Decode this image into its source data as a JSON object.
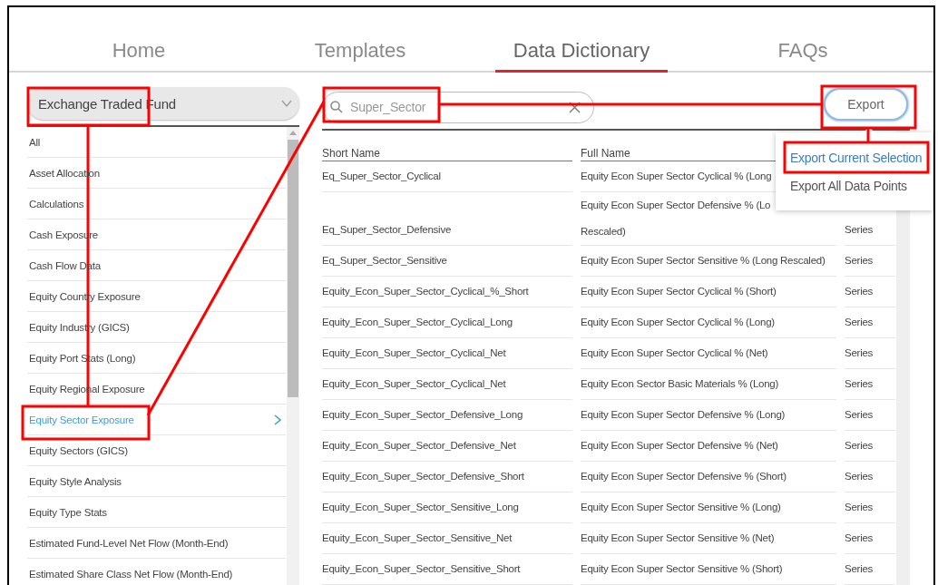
{
  "nav": {
    "tabs": [
      {
        "label": "Home",
        "selected": false
      },
      {
        "label": "Templates",
        "selected": false
      },
      {
        "label": "Data Dictionary",
        "selected": true
      },
      {
        "label": "FAQs",
        "selected": false
      }
    ]
  },
  "sidebar": {
    "dropdown": {
      "value": "Exchange Traded Fund"
    },
    "items": [
      {
        "label": "All",
        "selected": false
      },
      {
        "label": "Asset Allocation",
        "selected": false
      },
      {
        "label": "Calculations",
        "selected": false
      },
      {
        "label": "Cash Exposure",
        "selected": false
      },
      {
        "label": "Cash Flow Data",
        "selected": false
      },
      {
        "label": "Equity Country Exposure",
        "selected": false
      },
      {
        "label": "Equity Industry (GICS)",
        "selected": false
      },
      {
        "label": "Equity Port Stats (Long)",
        "selected": false
      },
      {
        "label": "Equity Regional Exposure",
        "selected": false
      },
      {
        "label": "Equity Sector Exposure",
        "selected": true
      },
      {
        "label": "Equity Sectors (GICS)",
        "selected": false
      },
      {
        "label": "Equity Style Analysis",
        "selected": false
      },
      {
        "label": "Equity Type Stats",
        "selected": false
      },
      {
        "label": "Estimated Fund-Level Net Flow (Month-End)",
        "selected": false
      },
      {
        "label": "Estimated Share Class Net Flow (Month-End)",
        "selected": false
      }
    ]
  },
  "search": {
    "value": "Super_Sector"
  },
  "export": {
    "label": "Export",
    "menu": [
      {
        "label": "Export Current Selection",
        "selected": true
      },
      {
        "label": "Export All Data Points",
        "selected": false
      }
    ]
  },
  "table": {
    "columns": [
      "Short Name",
      "Full Name"
    ],
    "rows": [
      {
        "short_name": "Eq_Super_Sector_Cyclical",
        "full_name_lines": [
          "Equity Econ Super Sector Cyclical % (Long"
        ]
      },
      {
        "short_name": "Eq_Super_Sector_Defensive",
        "full_name_lines": [
          "Equity Econ Super Sector Defensive % (Lo",
          "Rescaled)"
        ],
        "type": "Series"
      },
      {
        "short_name": "Eq_Super_Sector_Sensitive",
        "full_name_lines": [
          "Equity Econ Super Sector Sensitive % (Long Rescaled)"
        ],
        "type": "Series"
      },
      {
        "short_name": "Equity_Econ_Super_Sector_Cyclical_%_Short",
        "full_name_lines": [
          "Equity Econ Super Sector Cyclical % (Short)"
        ],
        "type": "Series"
      },
      {
        "short_name": "Equity_Econ_Super_Sector_Cyclical_Long",
        "full_name_lines": [
          "Equity Econ Super Sector Cyclical % (Long)"
        ],
        "type": "Series"
      },
      {
        "short_name": "Equity_Econ_Super_Sector_Cyclical_Net",
        "full_name_lines": [
          "Equity Econ Super Sector Cyclical % (Net)"
        ],
        "type": "Series"
      },
      {
        "short_name": "Equity_Econ_Super_Sector_Cyclical_Net",
        "full_name_lines": [
          "Equity Econ Sector Basic Materials % (Long)"
        ],
        "type": "Series"
      },
      {
        "short_name": "Equity_Econ_Super_Sector_Defensive_Long",
        "full_name_lines": [
          "Equity Econ Super Sector Defensive % (Long)"
        ],
        "type": "Series"
      },
      {
        "short_name": "Equity_Econ_Super_Sector_Defensive_Net",
        "full_name_lines": [
          "Equity Econ Super Sector Defensive % (Net)"
        ],
        "type": "Series"
      },
      {
        "short_name": "Equity_Econ_Super_Sector_Defensive_Short",
        "full_name_lines": [
          "Equity Econ Super Sector Defensive % (Short)"
        ],
        "type": "Series"
      },
      {
        "short_name": "Equity_Econ_Super_Sector_Sensitive_Long",
        "full_name_lines": [
          "Equity Econ Super Sector Sensitive % (Long)"
        ],
        "type": "Series"
      },
      {
        "short_name": "Equity_Econ_Super_Sector_Sensitive_Net",
        "full_name_lines": [
          "Equity Econ Super Sector Sensitive % (Net)"
        ],
        "type": "Series"
      },
      {
        "short_name": "Equity_Econ_Super_Sector_Sensitive_Short",
        "full_name_lines": [
          "Equity Econ Super Sector Sensitive % (Short)"
        ],
        "type": "Series"
      }
    ]
  }
}
